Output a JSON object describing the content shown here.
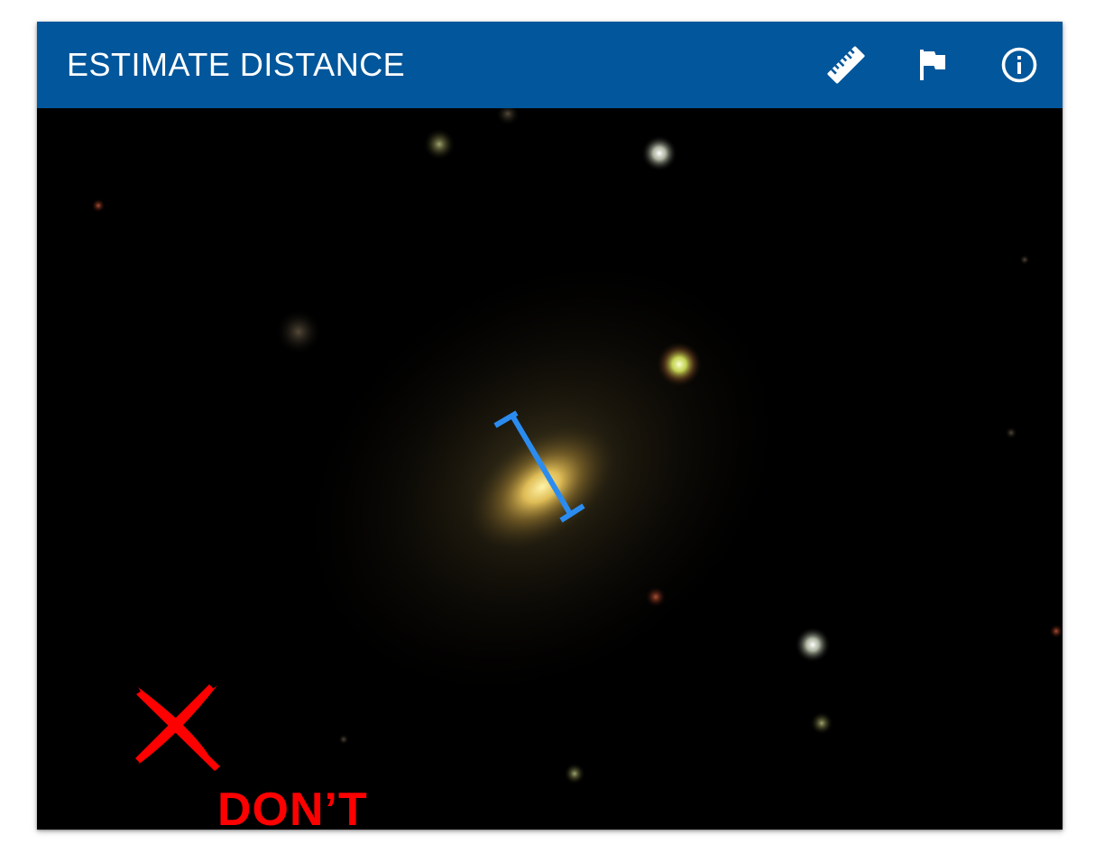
{
  "toolbar": {
    "title": "ESTIMATE DISTANCE",
    "background_color": "#02569b",
    "actions": [
      {
        "icon": "ruler-icon"
      },
      {
        "icon": "flag-icon"
      },
      {
        "icon": "info-icon"
      }
    ]
  },
  "viewer": {
    "annotation": {
      "mark_icon": "x-mark-icon",
      "label": "DON’T",
      "color": "#ff0000"
    },
    "measure_line_color": "#2b8cf0"
  }
}
